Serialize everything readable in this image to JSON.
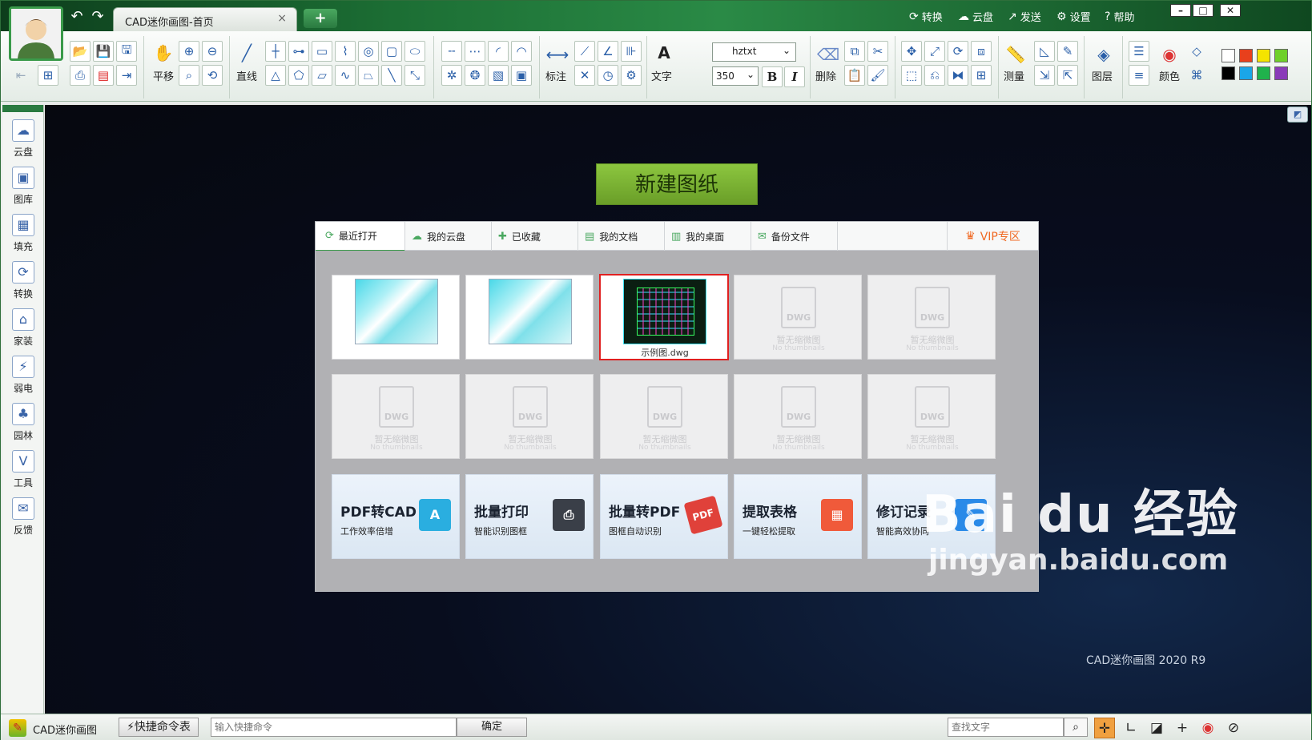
{
  "window": {
    "tab_title": "CAD迷你画图-首页",
    "tab_close": "×",
    "new_tab": "+",
    "undo": "↶",
    "redo": "↷"
  },
  "top_menu": [
    {
      "icon": "⟳",
      "label": "转换"
    },
    {
      "icon": "☁",
      "label": "云盘"
    },
    {
      "icon": "↗",
      "label": "发送"
    },
    {
      "icon": "⚙",
      "label": "设置"
    },
    {
      "icon": "?",
      "label": "帮助"
    }
  ],
  "window_controls": {
    "minimize": "–",
    "maximize": "□",
    "close": "✕"
  },
  "toolbar": {
    "pan_label": "平移",
    "line_label": "直线",
    "dimension_label": "标注",
    "text_label": "文字",
    "text_icon": "A",
    "delete_label": "删除",
    "measure_label": "测量",
    "layer_label": "图层",
    "color_label": "颜色",
    "font_name": "hztxt",
    "font_size": "350",
    "bold": "B",
    "italic": "I",
    "swatch_colors": [
      "#ffffff",
      "#e8401c",
      "#f4e400",
      "#6fd02a",
      "#000000",
      "#1aa6e8",
      "#20b24c",
      "#8a3ab8"
    ]
  },
  "sidebar": [
    {
      "icon": "☁",
      "label": "云盘"
    },
    {
      "icon": "▣",
      "label": "图库"
    },
    {
      "icon": "▦",
      "label": "填充"
    },
    {
      "icon": "⟳",
      "label": "转换"
    },
    {
      "icon": "⌂",
      "label": "家装"
    },
    {
      "icon": "⚡",
      "label": "弱电"
    },
    {
      "icon": "♣",
      "label": "园林"
    },
    {
      "icon": "V",
      "label": "工具"
    },
    {
      "icon": "✉",
      "label": "反馈"
    }
  ],
  "home": {
    "new_drawing": "新建图纸",
    "tabs": [
      {
        "icon": "⟳",
        "label": "最近打开"
      },
      {
        "icon": "☁",
        "label": "我的云盘"
      },
      {
        "icon": "✚",
        "label": "已收藏"
      },
      {
        "icon": "▤",
        "label": "我的文档"
      },
      {
        "icon": "▥",
        "label": "我的桌面"
      },
      {
        "icon": "✉",
        "label": "备份文件"
      }
    ],
    "vip": {
      "icon": "♛",
      "label": "VIP专区"
    },
    "selected_file": "示例图.dwg",
    "placeholder": {
      "badge": "DWG",
      "title": "暂无缩微图",
      "subtitle": "No thumbnails"
    },
    "features": [
      {
        "title": "PDF转CAD",
        "subtitle": "工作效率倍增",
        "icon": "A",
        "color": "#2aaee0"
      },
      {
        "title": "批量打印",
        "subtitle": "智能识别图框",
        "icon": "⎙",
        "color": "#3a3f48"
      },
      {
        "title": "批量转PDF",
        "subtitle": "图框自动识别",
        "icon": "PDF",
        "color": "#e0413a"
      },
      {
        "title": "提取表格",
        "subtitle": "一键轻松提取",
        "icon": "▦",
        "color": "#f05a3a"
      },
      {
        "title": "修订记录",
        "subtitle": "智能高效协同",
        "icon": "✎",
        "color": "#2a8ae8"
      }
    ]
  },
  "status": {
    "app_name": "CAD迷你画图",
    "shortcut_table": "⚡快捷命令表",
    "command_placeholder": "输入快捷命令",
    "ok": "确定",
    "find_placeholder": "查找文字",
    "find_icon": "⌕"
  },
  "watermark": {
    "logo": "Bai du 经验",
    "url": "jingyan.baidu.com",
    "version": "CAD迷你画图 2020 R9"
  }
}
